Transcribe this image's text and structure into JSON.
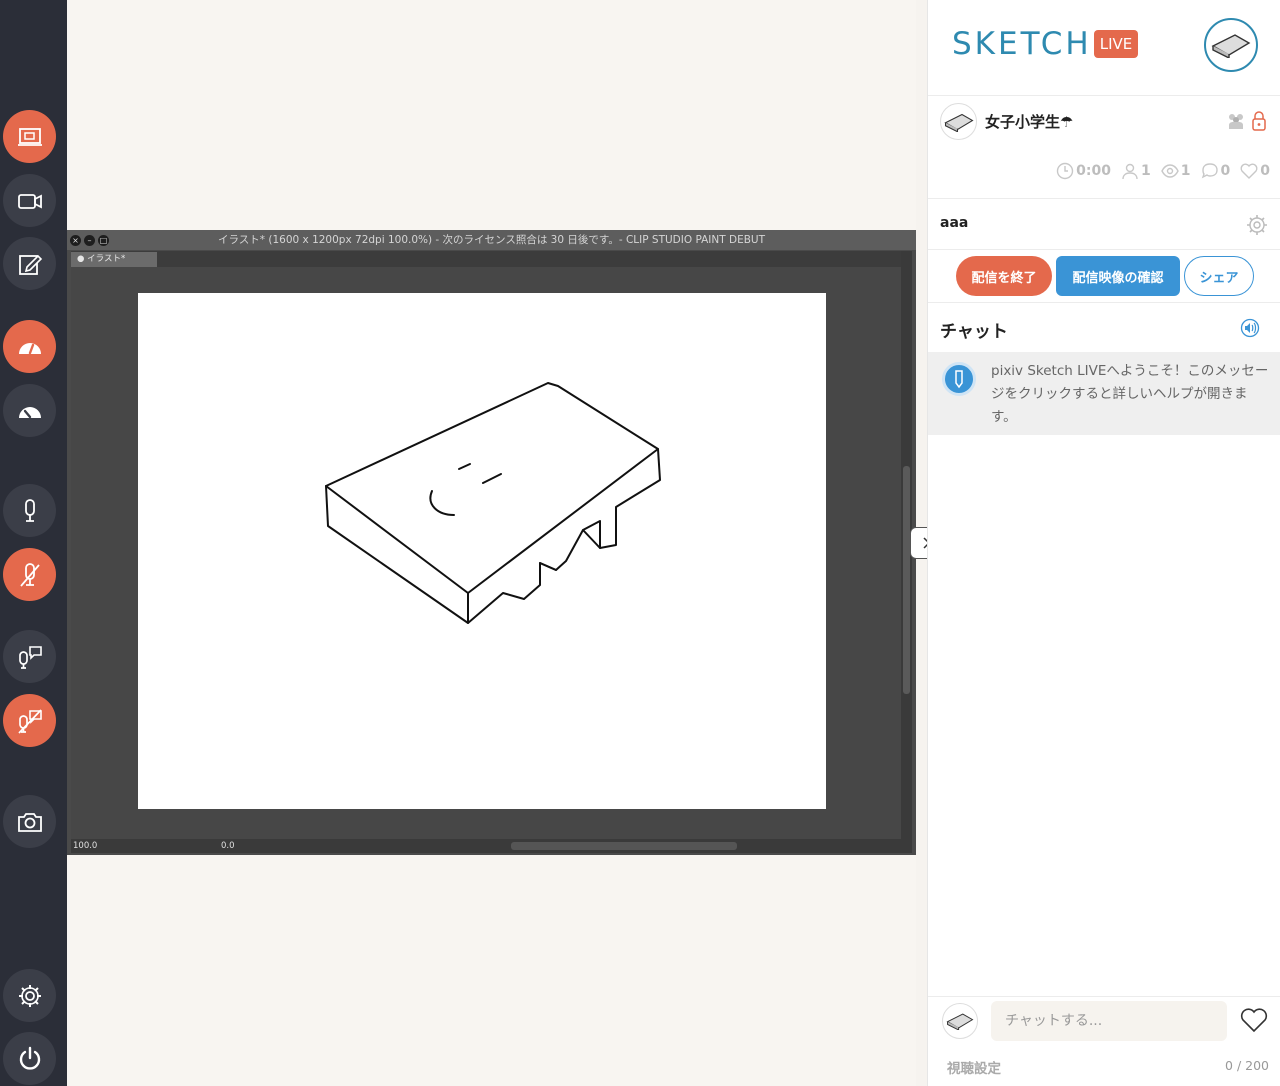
{
  "rail": {
    "buttons": [
      {
        "name": "screen-share-button",
        "icon": "monitor-icon",
        "active": true
      },
      {
        "name": "camera-button",
        "icon": "video-camera-icon",
        "active": false
      },
      {
        "name": "sketch-button",
        "icon": "pencil-note-icon",
        "active": false
      },
      {
        "name": "quality-high-button",
        "icon": "speedometer-icon",
        "active": true
      },
      {
        "name": "quality-low-button",
        "icon": "speedometer-icon",
        "active": false
      },
      {
        "name": "mic-button",
        "icon": "microphone-icon",
        "active": false
      },
      {
        "name": "mic-mute-button",
        "icon": "microphone-off-icon",
        "active": true
      },
      {
        "name": "voice-chat-button",
        "icon": "mic-chat-icon",
        "active": false
      },
      {
        "name": "voice-chat-mute-button",
        "icon": "mic-chat-off-icon",
        "active": true
      },
      {
        "name": "snapshot-button",
        "icon": "camera-icon",
        "active": false
      },
      {
        "name": "settings-button",
        "icon": "gear-icon",
        "active": false
      },
      {
        "name": "power-button",
        "icon": "power-icon",
        "active": false
      }
    ]
  },
  "app_window": {
    "title": "イラスト* (1600 x 1200px 72dpi 100.0%)  - 次のライセンス照合は 30 日後です。- CLIP STUDIO PAINT DEBUT",
    "tab": "イラスト*",
    "zoom": "100.0",
    "angle": "0.0"
  },
  "panel": {
    "logo": "SKETCH",
    "live_badge": "LIVE",
    "room_title": "女子小学生☂",
    "stats": {
      "time": "0:00",
      "users": "1",
      "views": "1",
      "comments": "0",
      "hearts": "0"
    },
    "description": "aaa",
    "buttons": {
      "end": "配信を終了",
      "confirm": "配信映像の確認",
      "share": "シェア"
    },
    "chat_heading": "チャット",
    "welcome_message": "pixiv Sketch LIVEへようこそ！このメッセージをクリックすると詳しいヘルプが開きます。",
    "chat_placeholder": "チャットする...",
    "view_settings": "視聴設定",
    "char_count": "0 / 200"
  },
  "colors": {
    "accent_orange": "#e4694c",
    "accent_blue": "#3a94d6",
    "logo_blue": "#2e8ab0",
    "rail": "#2b2e38"
  }
}
